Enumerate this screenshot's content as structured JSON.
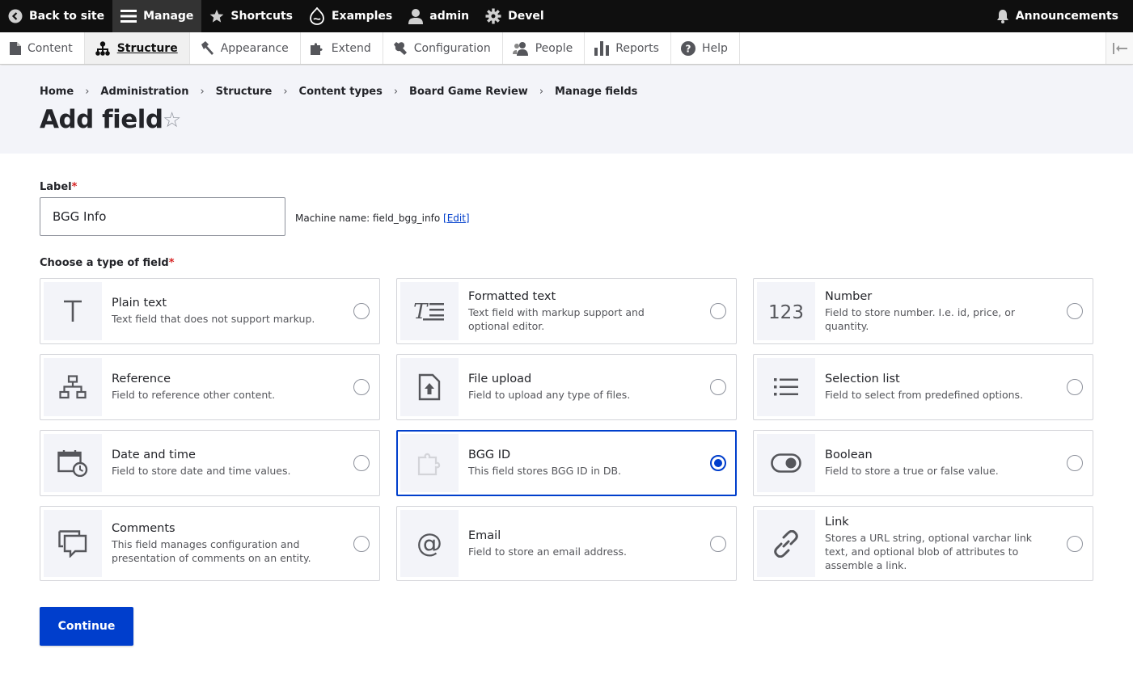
{
  "toolbar": {
    "items": [
      {
        "label": "Back to site",
        "icon": "arrow-left-circle-icon"
      },
      {
        "label": "Manage",
        "icon": "hamburger-icon"
      },
      {
        "label": "Shortcuts",
        "icon": "star-icon"
      },
      {
        "label": "Examples",
        "icon": "drupal-drop-icon"
      },
      {
        "label": "admin",
        "icon": "user-icon"
      },
      {
        "label": "Devel",
        "icon": "gear-icon"
      }
    ],
    "announcements": {
      "label": "Announcements",
      "icon": "bell-icon"
    }
  },
  "tray": {
    "items": [
      {
        "label": "Content",
        "icon": "document-icon",
        "active": false
      },
      {
        "label": "Structure",
        "icon": "sitemap-icon",
        "active": true
      },
      {
        "label": "Appearance",
        "icon": "hammer-icon",
        "active": false
      },
      {
        "label": "Extend",
        "icon": "puzzle-icon",
        "active": false
      },
      {
        "label": "Configuration",
        "icon": "wrench-icon",
        "active": false
      },
      {
        "label": "People",
        "icon": "people-icon",
        "active": false
      },
      {
        "label": "Reports",
        "icon": "bar-chart-icon",
        "active": false
      },
      {
        "label": "Help",
        "icon": "help-icon",
        "active": false
      }
    ]
  },
  "breadcrumb": [
    "Home",
    "Administration",
    "Structure",
    "Content types",
    "Board Game Review",
    "Manage fields"
  ],
  "breadcrumb_separator": "›",
  "page": {
    "title": "Add field",
    "shortcut_star": "☆"
  },
  "form": {
    "label_title": "Label",
    "required_mark": "*",
    "label_value": "BGG Info",
    "machine_name_prefix": "Machine name: field_bgg_info",
    "machine_name_edit": "[Edit]",
    "type_title": "Choose a type of field",
    "field_types": [
      {
        "title": "Plain text",
        "desc": "Text field that does not support markup.",
        "icon": "text-t-icon",
        "selected": false
      },
      {
        "title": "Formatted text",
        "desc": "Text field with markup support and optional editor.",
        "icon": "formatted-text-icon",
        "selected": false
      },
      {
        "title": "Number",
        "desc": "Field to store number. I.e. id, price, or quantity.",
        "icon": "number-123-icon",
        "selected": false
      },
      {
        "title": "Reference",
        "desc": "Field to reference other content.",
        "icon": "hierarchy-icon",
        "selected": false
      },
      {
        "title": "File upload",
        "desc": "Field to upload any type of files.",
        "icon": "file-upload-icon",
        "selected": false
      },
      {
        "title": "Selection list",
        "desc": "Field to select from predefined options.",
        "icon": "list-icon",
        "selected": false
      },
      {
        "title": "Date and time",
        "desc": "Field to store date and time values.",
        "icon": "calendar-clock-icon",
        "selected": false
      },
      {
        "title": "BGG ID",
        "desc": "This field stores BGG ID in DB.",
        "icon": "puzzle-piece-icon",
        "selected": true
      },
      {
        "title": "Boolean",
        "desc": "Field to store a true or false value.",
        "icon": "toggle-icon",
        "selected": false
      },
      {
        "title": "Comments",
        "desc": "This field manages configuration and presentation of comments on an entity.",
        "icon": "comments-icon",
        "selected": false
      },
      {
        "title": "Email",
        "desc": "Field to store an email address.",
        "icon": "at-sign-icon",
        "selected": false
      },
      {
        "title": "Link",
        "desc": "Stores a URL string, optional varchar link text, and optional blob of attributes to assemble a link.",
        "icon": "link-icon",
        "selected": false
      }
    ],
    "continue_label": "Continue"
  },
  "colors": {
    "accent": "#003ecc",
    "toolbar_bg": "#0f0f0f",
    "header_bg": "#f3f4f9",
    "required": "#d72222"
  }
}
